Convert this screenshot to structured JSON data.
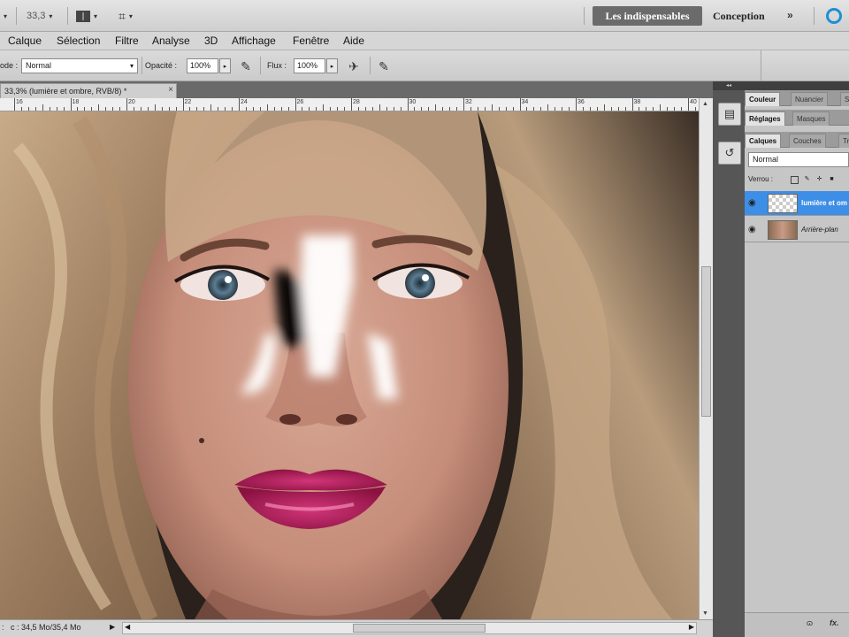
{
  "appbar": {
    "zoom_value": "33,3",
    "workspace_active": "Les indispensables",
    "workspace_other": "Conception",
    "more_label": "»",
    "arrange_icon": "grid-layout-icon",
    "screen_mode_icon": "screen-mode-icon"
  },
  "menubar": {
    "items": [
      "Calque",
      "Sélection",
      "Filtre",
      "Analyse",
      "3D",
      "Affichage",
      "Fenêtre",
      "Aide"
    ]
  },
  "options": {
    "mode_label": "ode :",
    "mode_value": "Normal",
    "opacity_label": "Opacité :",
    "opacity_value": "100%",
    "flow_label": "Flux :",
    "flow_value": "100%"
  },
  "document": {
    "tab_title": "33,3% (lumière et ombre, RVB/8) *",
    "close_label": "×",
    "ruler_labels": [
      "16",
      "18",
      "20",
      "22",
      "24",
      "26",
      "28",
      "30",
      "32",
      "34",
      "36",
      "38",
      "40"
    ],
    "status_zoom": ":",
    "status_info": "c : 34,5 Mo/35,4 Mo"
  },
  "panels": {
    "top_tabs": [
      "Couleur",
      "Nuancier",
      "Styles"
    ],
    "mid_tabs": [
      "Réglages",
      "Masques"
    ],
    "layer_tabs": [
      "Calques",
      "Couches",
      "Tracés"
    ],
    "blend_mode": "Normal",
    "lock_label": "Verrou :",
    "layers": [
      {
        "name": "lumière et ombre",
        "selected": true,
        "thumb": "transparent"
      },
      {
        "name": "Arrière-plan",
        "selected": false,
        "thumb": "portrait"
      }
    ],
    "footer_icons": "ɷ  fx."
  },
  "colors": {
    "accent": "#3d8ee6",
    "workspace_bg": "#6b6b6b"
  }
}
